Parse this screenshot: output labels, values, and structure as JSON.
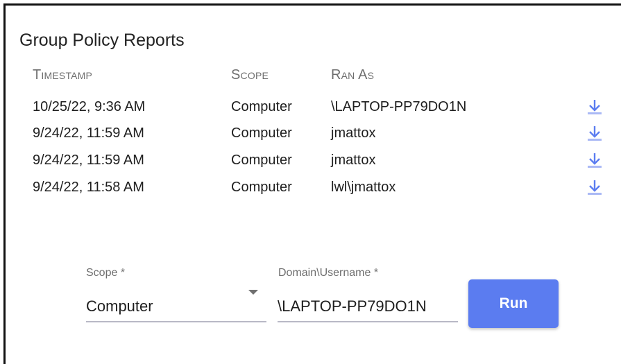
{
  "title": "Group Policy Reports",
  "columns": {
    "timestamp": "Timestamp",
    "scope": "Scope",
    "ran_as": "Ran As"
  },
  "rows": [
    {
      "timestamp": "10/25/22, 9:36 AM",
      "scope": "Computer",
      "ran_as": "\\LAPTOP-PP79DO1N"
    },
    {
      "timestamp": "9/24/22, 11:59 AM",
      "scope": "Computer",
      "ran_as": "jmattox"
    },
    {
      "timestamp": "9/24/22, 11:59 AM",
      "scope": "Computer",
      "ran_as": "jmattox"
    },
    {
      "timestamp": "9/24/22, 11:58 AM",
      "scope": "Computer",
      "ran_as": "lwl\\jmattox"
    }
  ],
  "form": {
    "scope_label": "Scope *",
    "scope_value": "Computer",
    "domain_label": "Domain\\Username *",
    "domain_value": "\\LAPTOP-PP79DO1N",
    "run_label": "Run"
  },
  "icons": {
    "download": "download-icon",
    "dropdown": "dropdown-arrow-icon"
  },
  "colors": {
    "accent": "#5b7cf0",
    "download_icon": "#5b7cf0"
  }
}
